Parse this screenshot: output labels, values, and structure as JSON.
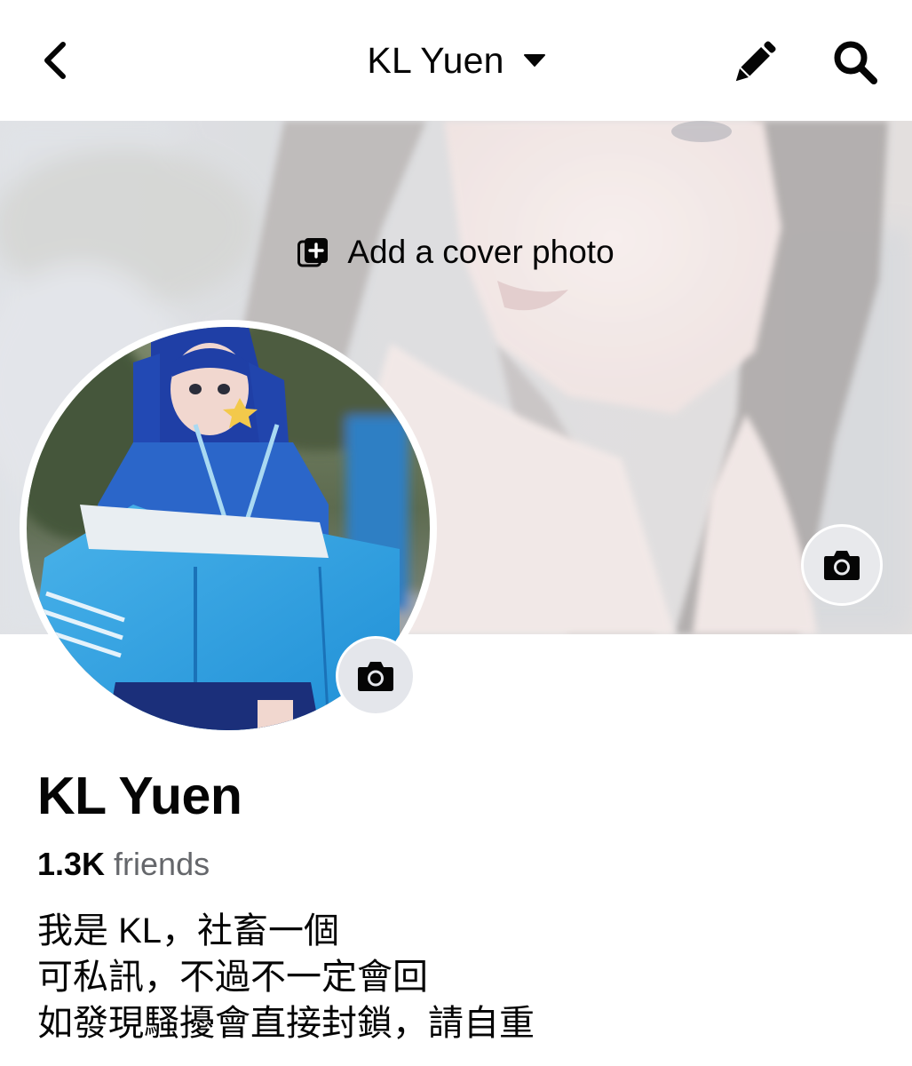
{
  "header": {
    "title": "KL Yuen",
    "back_icon": "chevron-left-icon",
    "caret_icon": "caret-down-icon",
    "edit_icon": "pencil-icon",
    "search_icon": "search-icon"
  },
  "cover": {
    "cta_label": "Add a cover photo",
    "cta_icon": "add-photo-icon",
    "camera_icon": "camera-icon"
  },
  "profile": {
    "camera_icon": "camera-icon",
    "name": "KL Yuen",
    "friends_count": "1.3K",
    "friends_label": "friends",
    "bio_lines": [
      "我是 KL，社畜一個",
      "可私訊，不過不一定會回",
      "如發現騷擾會直接封鎖，請自重"
    ]
  },
  "colors": {
    "text_primary": "#050505",
    "text_secondary": "#65676b",
    "camera_button_bg": "#e4e6eb",
    "background": "#ffffff"
  }
}
